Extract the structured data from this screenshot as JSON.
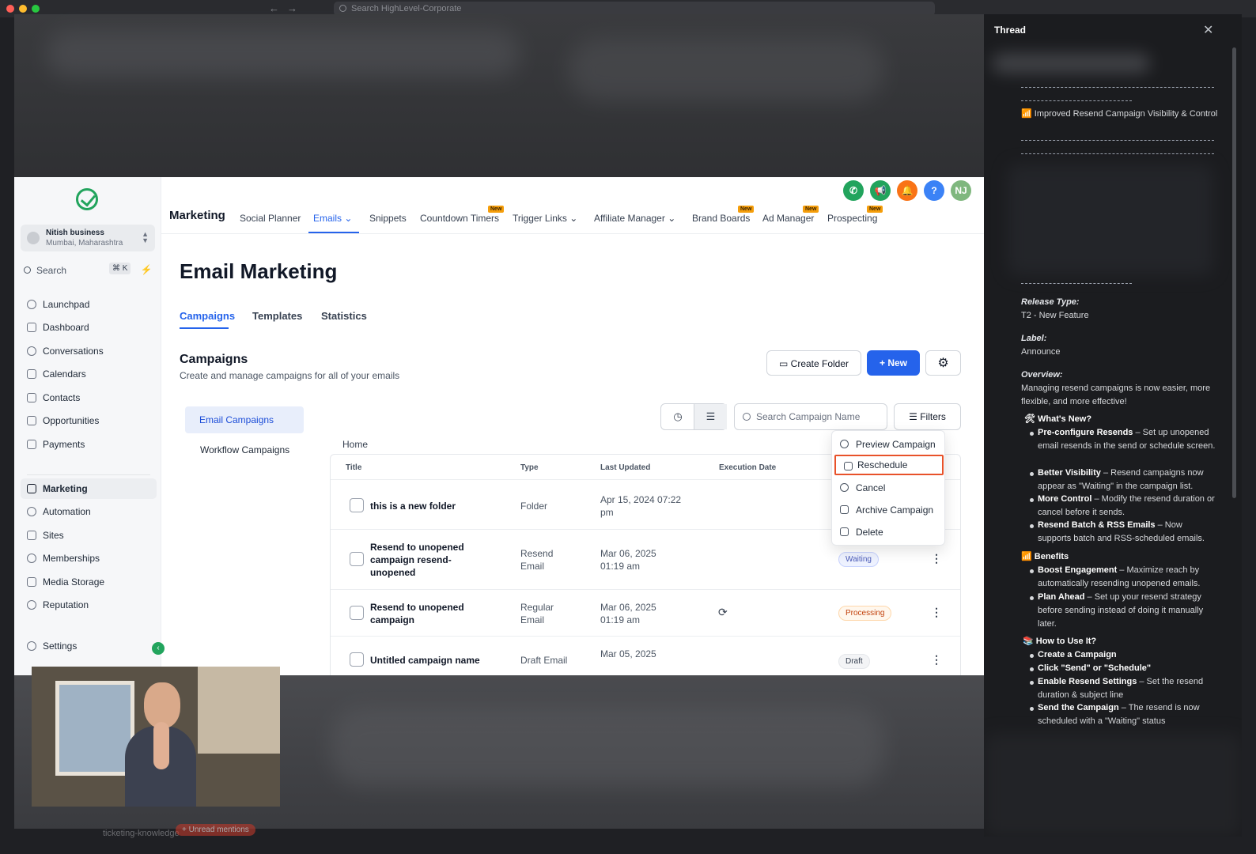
{
  "browser": {
    "omnibox_placeholder": "Search HighLevel-Corporate"
  },
  "sidebar": {
    "account_name": "Nitish business",
    "account_location": "Mumbai, Maharashtra",
    "search_label": "Search",
    "search_shortcut": "⌘ K",
    "items": [
      {
        "label": "Launchpad",
        "icon": "rocket-icon"
      },
      {
        "label": "Dashboard",
        "icon": "grid-icon"
      },
      {
        "label": "Conversations",
        "icon": "chat-icon"
      },
      {
        "label": "Calendars",
        "icon": "calendar-icon"
      },
      {
        "label": "Contacts",
        "icon": "contacts-icon"
      },
      {
        "label": "Opportunities",
        "icon": "pipeline-icon"
      },
      {
        "label": "Payments",
        "icon": "payment-icon"
      },
      {
        "label": "Marketing",
        "icon": "send-icon"
      },
      {
        "label": "Automation",
        "icon": "automation-icon"
      },
      {
        "label": "Sites",
        "icon": "sites-icon"
      },
      {
        "label": "Memberships",
        "icon": "membership-icon"
      },
      {
        "label": "Media Storage",
        "icon": "image-icon"
      },
      {
        "label": "Reputation",
        "icon": "star-icon"
      }
    ],
    "settings_label": "Settings",
    "active_item": "Marketing"
  },
  "topnav": {
    "title": "Marketing",
    "items": [
      {
        "label": "Social Planner",
        "new": false
      },
      {
        "label": "Emails",
        "new": false
      },
      {
        "label": "Snippets",
        "new": false
      },
      {
        "label": "Countdown Timers",
        "new": true
      },
      {
        "label": "Trigger Links",
        "new": false
      },
      {
        "label": "Affiliate Manager",
        "new": false
      },
      {
        "label": "Brand Boards",
        "new": true
      },
      {
        "label": "Ad Manager",
        "new": true
      },
      {
        "label": "Prospecting",
        "new": true
      }
    ],
    "new_tag": "New",
    "active": "Emails",
    "avatar_initials": "NJ",
    "help_label": "?"
  },
  "page": {
    "title": "Email Marketing",
    "tabs": [
      "Campaigns",
      "Templates",
      "Statistics"
    ],
    "active_tab": "Campaigns",
    "section_title": "Campaigns",
    "section_subtitle": "Create and manage campaigns for all of your emails",
    "create_folder_label": "Create Folder",
    "new_label": "New",
    "left_nav": [
      "Email Campaigns",
      "Workflow Campaigns"
    ],
    "search_placeholder": "Search Campaign Name",
    "filters_label": "Filters",
    "breadcrumb": "Home"
  },
  "table": {
    "columns": [
      "Title",
      "Type",
      "Last Updated",
      "Execution Date"
    ],
    "rows": [
      {
        "title": "this is a new folder",
        "type": "Folder",
        "updated": "Apr 15, 2024 07:22 pm",
        "status": ""
      },
      {
        "title": "Resend to unopened campaign resend-unopened",
        "type": "Resend Email",
        "updated": "Mar 06, 2025 01:19 am",
        "status": "Waiting"
      },
      {
        "title": "Resend to unopened campaign",
        "type": "Regular Email",
        "updated": "Mar 06, 2025 01:19 am",
        "status": "Processing"
      },
      {
        "title": "Untitled campaign name",
        "type": "Draft Email",
        "updated": "Mar 05, 2025",
        "status": "Draft"
      }
    ]
  },
  "row_menu": {
    "items": [
      "Preview Campaign",
      "Reschedule",
      "Cancel",
      "Archive Campaign",
      "Delete"
    ],
    "highlighted": "Reschedule"
  },
  "thread": {
    "title": "Thread",
    "heading": "Improved Resend Campaign Visibility & Control",
    "release_type_label": "Release Type:",
    "release_type": "T2 - New Feature",
    "label_label": "Label:",
    "label": "Announce",
    "overview_label": "Overview:",
    "overview": "Managing resend campaigns is now easier, more flexible, and more effective!",
    "whats_new": "What's New?",
    "new_items": [
      {
        "bold": "Pre-configure Resends",
        "text": " – Set up unopened email resends in the send or schedule screen."
      },
      {
        "bold": "Better Visibility",
        "text": " – Resend campaigns now appear as \"Waiting\" in the campaign list."
      },
      {
        "bold": "More Control",
        "text": " – Modify the resend duration or cancel before it sends."
      },
      {
        "bold": "Resend Batch & RSS Emails",
        "text": " – Now supports batch and RSS-scheduled emails."
      }
    ],
    "benefits": "Benefits",
    "benefit_items": [
      {
        "bold": "Boost Engagement",
        "text": " – Maximize reach by automatically resending unopened emails."
      },
      {
        "bold": "Plan Ahead",
        "text": " – Set up your resend strategy before sending instead of doing it manually later."
      }
    ],
    "how_to": "How to Use It?",
    "how_items": [
      {
        "bold": "Create a Campaign",
        "text": ""
      },
      {
        "bold": "Click \"Send\" or \"Schedule\"",
        "text": ""
      },
      {
        "bold": "Enable Resend Settings",
        "text": " – Set the resend duration & subject line"
      },
      {
        "bold": "Send the Campaign",
        "text": " – The resend is now scheduled with a \"Waiting\" status"
      }
    ]
  },
  "bottom": {
    "channel": "ticketing-knowledge",
    "unread": "+ Unread mentions"
  }
}
